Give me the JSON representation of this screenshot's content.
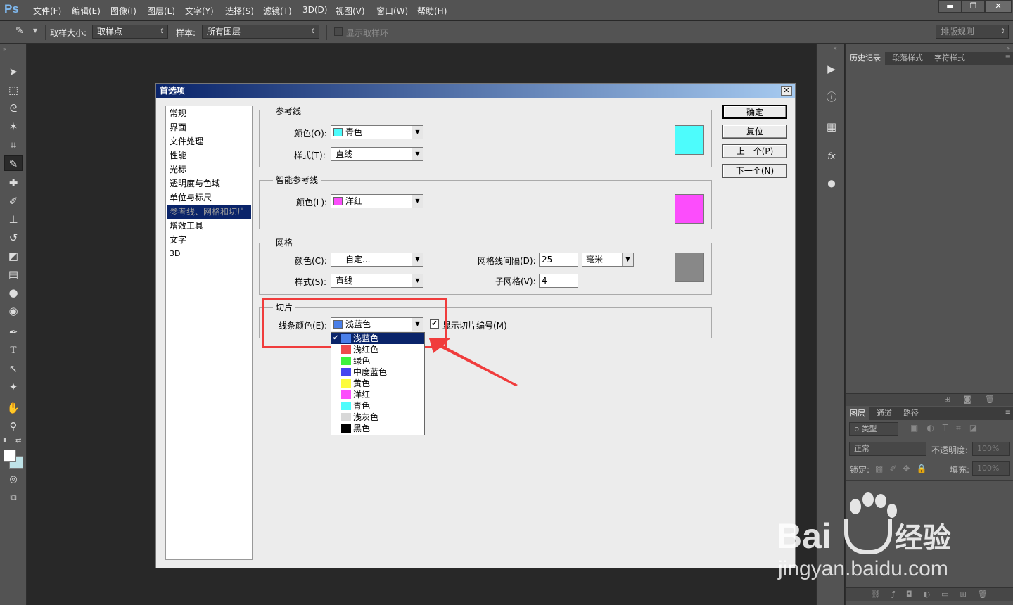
{
  "app": {
    "logo": "Ps"
  },
  "menubar": {
    "items": [
      "文件(F)",
      "编辑(E)",
      "图像(I)",
      "图层(L)",
      "文字(Y)",
      "选择(S)",
      "滤镜(T)",
      "3D(D)",
      "视图(V)",
      "窗口(W)",
      "帮助(H)"
    ]
  },
  "window_controls": {
    "minimize": "▬",
    "restore": "❐",
    "close": "✕"
  },
  "options_bar": {
    "sample_size_label": "取样大小:",
    "sample_size_value": "取样点",
    "sample_label": "样本:",
    "sample_value": "所有图层",
    "show_ring_label": "显示取样环",
    "workspace_value": "排版规则"
  },
  "right_panel": {
    "top_tabs": [
      "历史记录",
      "段落样式",
      "字符样式"
    ],
    "layer_tabs": [
      "图层",
      "通道",
      "路径"
    ],
    "filter_kind": "ρ 类型",
    "blend_mode": "正常",
    "opacity_label": "不透明度:",
    "opacity_value": "100%",
    "lock_label": "锁定:",
    "fill_label": "填充:",
    "fill_value": "100%"
  },
  "dialog": {
    "title": "首选项",
    "close": "✕",
    "categories": [
      "常规",
      "界面",
      "文件处理",
      "性能",
      "光标",
      "透明度与色域",
      "单位与标尺",
      "参考线、网格和切片",
      "增效工具",
      "文字",
      "3D"
    ],
    "selected_category_index": 7,
    "buttons": {
      "ok": "确定",
      "reset": "复位",
      "prev": "上一个(P)",
      "next": "下一个(N)"
    },
    "guides": {
      "title": "参考线",
      "color_label": "颜色(O):",
      "color_value": "青色",
      "color_hex": "#4dfcfc",
      "style_label": "样式(T):",
      "style_value": "直线"
    },
    "smart_guides": {
      "title": "智能参考线",
      "color_label": "颜色(L):",
      "color_value": "洋红",
      "color_hex": "#fc4dfc"
    },
    "grid": {
      "title": "网格",
      "color_label": "颜色(C):",
      "color_value": "自定...",
      "color_hex": "#888888",
      "style_label": "样式(S):",
      "style_value": "直线",
      "spacing_label": "网格线间隔(D):",
      "spacing_value": "25",
      "unit_value": "毫米",
      "subdiv_label": "子网格(V):",
      "subdiv_value": "4"
    },
    "slices": {
      "title": "切片",
      "line_color_label": "线条颜色(E):",
      "line_color_value": "浅蓝色",
      "line_color_hex": "#4a7fe8",
      "show_numbers_label": "显示切片编号(M)",
      "show_numbers_checked": "✔"
    },
    "dropdown_options": [
      {
        "label": "浅蓝色",
        "color": "#4a7fe8",
        "selected": true
      },
      {
        "label": "浅红色",
        "color": "#ef4b4b"
      },
      {
        "label": "绿色",
        "color": "#3ef23e"
      },
      {
        "label": "中度蓝色",
        "color": "#4545f0"
      },
      {
        "label": "黄色",
        "color": "#fcfc3c"
      },
      {
        "label": "洋红",
        "color": "#fc4dfc"
      },
      {
        "label": "青色",
        "color": "#4dfcfc"
      },
      {
        "label": "浅灰色",
        "color": "#d8d8d8"
      },
      {
        "label": "黑色",
        "color": "#000000"
      }
    ]
  },
  "watermark": {
    "brand": "Bai",
    "brand_cn": "经验",
    "url": "jingyan.baidu.com"
  }
}
